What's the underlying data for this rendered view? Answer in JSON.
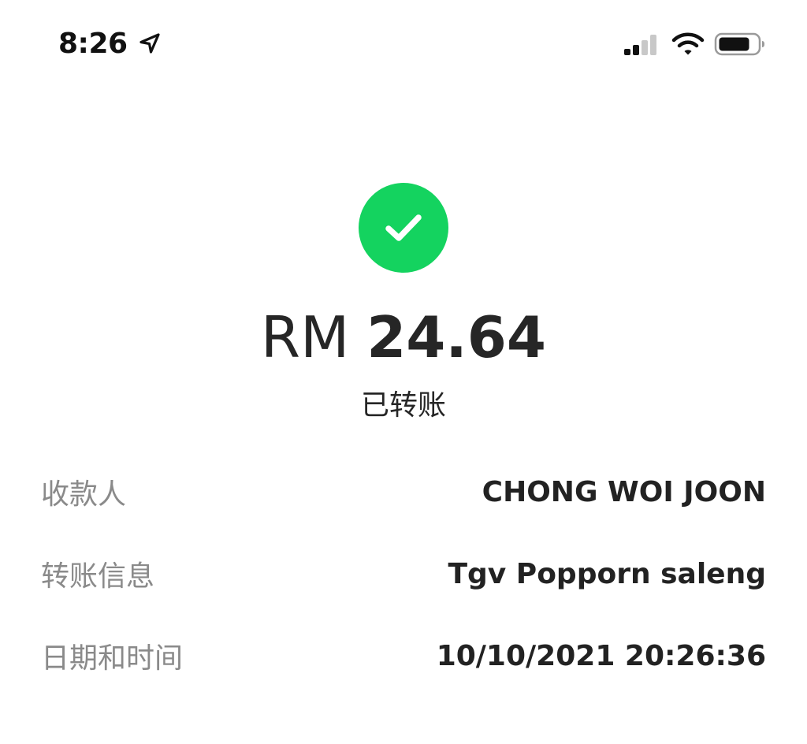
{
  "status_bar": {
    "time": "8:26",
    "icons": [
      "location-arrow-icon",
      "cellular-signal-icon",
      "wifi-icon",
      "battery-icon"
    ]
  },
  "transfer": {
    "currency": "RM",
    "amount": "24.64",
    "status": "已转账",
    "status_icon": "check-icon",
    "accent_color": "#14d35f"
  },
  "details": [
    {
      "label": "收款人",
      "value": "CHONG WOI JOON"
    },
    {
      "label": "转账信息",
      "value": "Tgv Popporn saleng"
    },
    {
      "label": "日期和时间",
      "value": "10/10/2021 20:26:36"
    }
  ]
}
